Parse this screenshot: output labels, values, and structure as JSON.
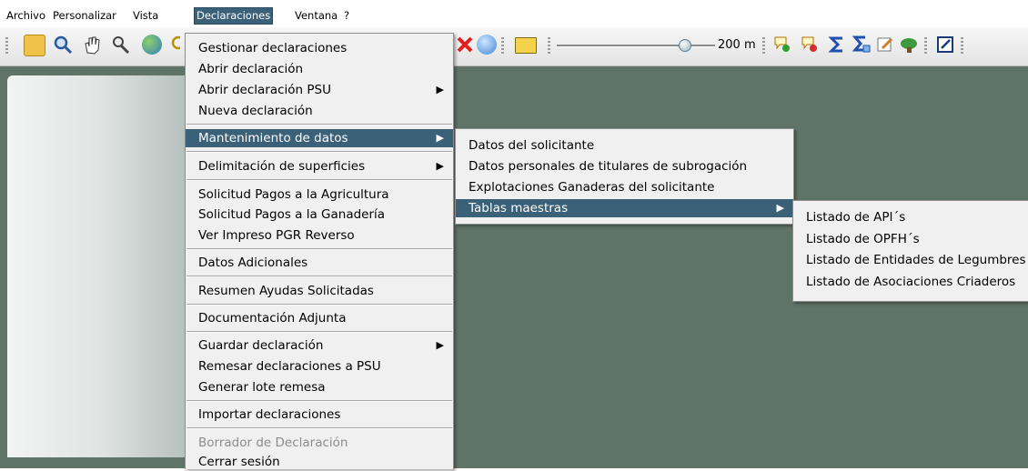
{
  "menubar": {
    "items": [
      {
        "label": "Archivo"
      },
      {
        "label": "Personalizar"
      },
      {
        "label": "Vista"
      },
      {
        "label": "Declaraciones"
      },
      {
        "label": "Ventana"
      },
      {
        "label": "?"
      }
    ]
  },
  "toolbar": {
    "scale_label": "200 m",
    "slider_value": 0.81,
    "icons": [
      "open-file-icon",
      "zoom-icon",
      "pan-hand-icon",
      "identify-icon",
      "globe-icon",
      "search-icon",
      "delete-icon",
      "info-icon",
      "ruler-icon",
      "add-point-icon",
      "remove-point-icon",
      "sum-icon",
      "stats-icon",
      "edit-icon",
      "vegetation-icon",
      "form-icon"
    ]
  },
  "declaraciones_menu": {
    "items": [
      {
        "label": "Gestionar declaraciones"
      },
      {
        "label": "Abrir declaración"
      },
      {
        "label": "Abrir declaración PSU"
      },
      {
        "label": "Nueva declaración"
      },
      {
        "label": "Mantenimiento de datos"
      },
      {
        "label": "Delimitación de superficies"
      },
      {
        "label": "Solicitud Pagos a la Agricultura"
      },
      {
        "label": "Solicitud Pagos a la Ganadería"
      },
      {
        "label": "Ver Impreso PGR Reverso"
      },
      {
        "label": "Datos Adicionales"
      },
      {
        "label": "Resumen Ayudas Solicitadas"
      },
      {
        "label": "Documentación Adjunta"
      },
      {
        "label": "Guardar declaración"
      },
      {
        "label": "Remesar declaraciones a PSU"
      },
      {
        "label": "Generar lote remesa"
      },
      {
        "label": "Importar declaraciones"
      },
      {
        "label": "Borrador de Declaración"
      },
      {
        "label": "Cerrar sesión"
      }
    ]
  },
  "mantenimiento_submenu": {
    "items": [
      {
        "label": "Datos del solicitante"
      },
      {
        "label": "Datos personales de titulares de subrogación"
      },
      {
        "label": "Explotaciones Ganaderas del solicitante"
      },
      {
        "label": "Tablas maestras"
      }
    ]
  },
  "tablas_submenu": {
    "items": [
      {
        "label": "Listado de API´s"
      },
      {
        "label": "Listado de OPFH´s"
      },
      {
        "label": "Listado de Entidades de Legumbres"
      },
      {
        "label": "Listado de Asociaciones Criaderos"
      }
    ]
  },
  "colors": {
    "highlight": "#3b6178",
    "workspace": "#5f7369",
    "menu_bg": "#f0f0f0"
  }
}
